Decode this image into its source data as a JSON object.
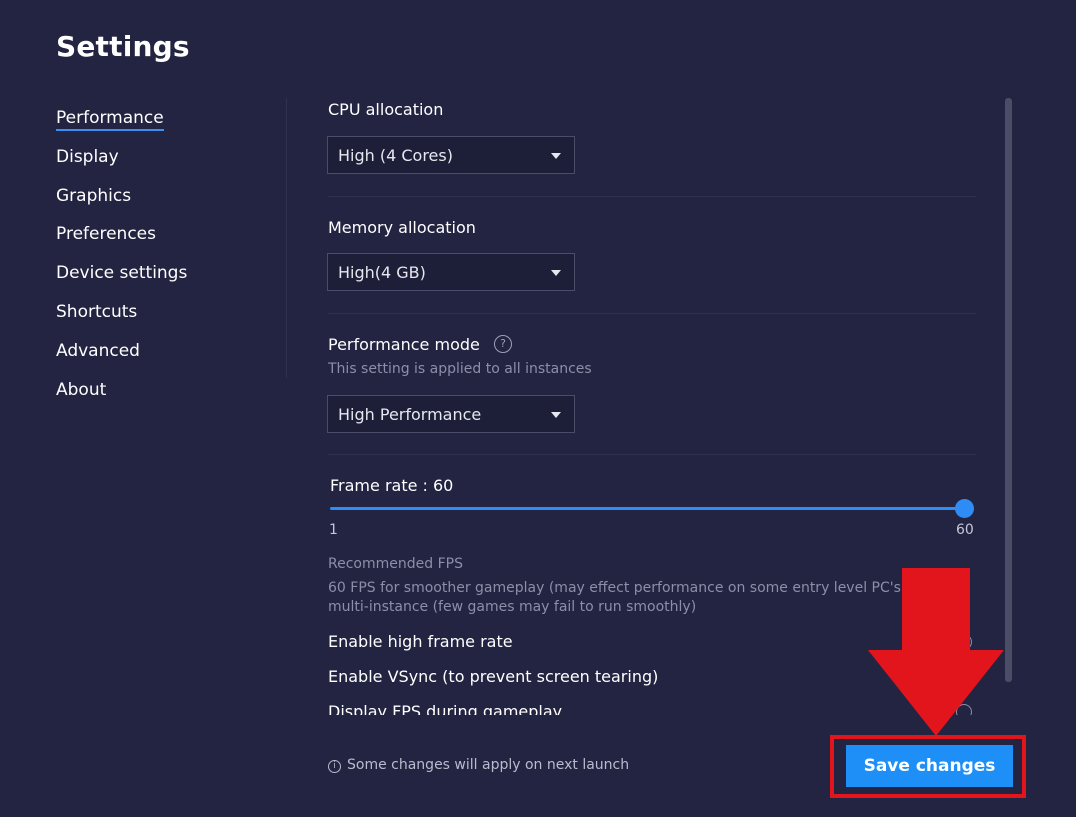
{
  "window": {
    "title": "Settings"
  },
  "sidebar": {
    "items": [
      {
        "label": "Performance",
        "active": true
      },
      {
        "label": "Display"
      },
      {
        "label": "Graphics"
      },
      {
        "label": "Preferences"
      },
      {
        "label": "Device settings"
      },
      {
        "label": "Shortcuts"
      },
      {
        "label": "Advanced"
      },
      {
        "label": "About"
      }
    ]
  },
  "performance": {
    "cpu": {
      "label": "CPU allocation",
      "value": "High (4 Cores)"
    },
    "memory": {
      "label": "Memory allocation",
      "value": "High(4 GB)"
    },
    "mode": {
      "label": "Performance mode",
      "hint": "This setting is applied to all instances",
      "value": "High Performance"
    },
    "frame_rate": {
      "label": "Frame rate : 60",
      "min": "1",
      "max": "60",
      "value": 60
    },
    "recommended": {
      "title": "Recommended FPS",
      "line1": "60 FPS for smoother gameplay (may effect performance on some entry level PC's) and",
      "line2": "multi-instance (few games may fail to run smoothly)"
    },
    "toggles": {
      "high_frame_rate": "Enable high frame rate",
      "vsync": "Enable VSync (to prevent screen tearing)",
      "display_fps": "Display FPS during gameplay"
    }
  },
  "footer": {
    "note": "Some changes will apply on next launch",
    "save_label": "Save changes"
  },
  "colors": {
    "background": "#222441",
    "accent": "#1e8ff6",
    "highlight": "#e2151c"
  }
}
